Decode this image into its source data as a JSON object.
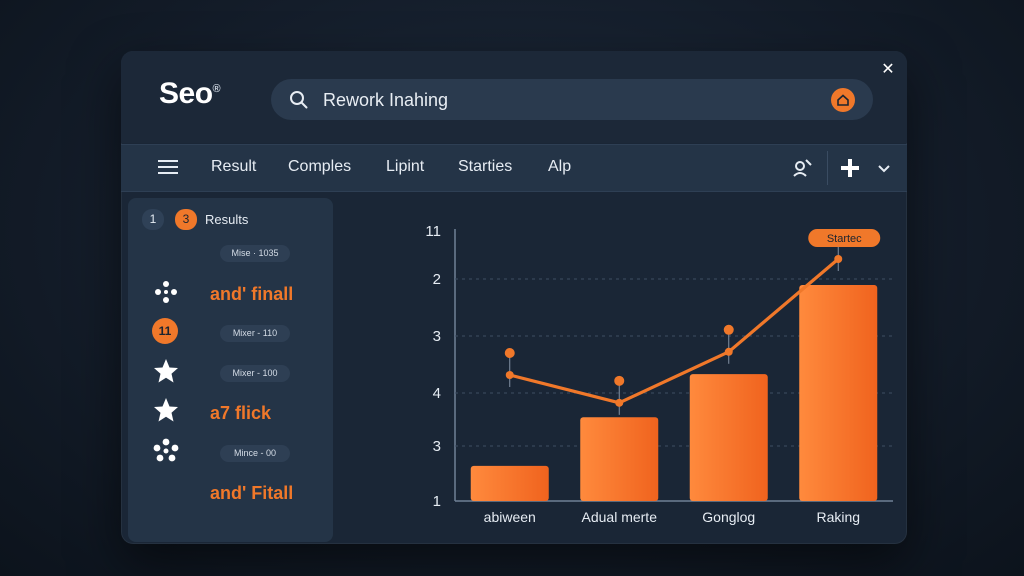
{
  "app": {
    "logo": "Seo",
    "logo_mark": "®",
    "search_value": "Rework Inahing"
  },
  "toolbar": {
    "tabs": [
      "Result",
      "Comples",
      "Lipint",
      "Starties",
      "Alp"
    ]
  },
  "sidebar": {
    "chip_1": "1",
    "chip_3": "3",
    "results_label": "Results",
    "pills": [
      "Mise · 1035",
      "Mixer - 110",
      "Mixer - 100",
      "Mince - 00"
    ],
    "labels": [
      "and' finall",
      "a7 flick",
      "and' Fitall"
    ],
    "badge_11": "11"
  },
  "colors": {
    "accent": "#f0782a",
    "panel": "#243447",
    "window": "#1a2636"
  },
  "chart_data": {
    "type": "bar",
    "categories": [
      "abiween",
      "Adual merte",
      "Gonglog",
      "Raking"
    ],
    "y_tick_labels": [
      "11",
      "2",
      "3",
      "4",
      "3",
      "1"
    ],
    "bar_values": [
      0.13,
      0.31,
      0.47,
      0.8
    ],
    "line_values": [
      0.5,
      0.38,
      0.6,
      1.0
    ],
    "annotation": "Startec",
    "grid": true
  }
}
